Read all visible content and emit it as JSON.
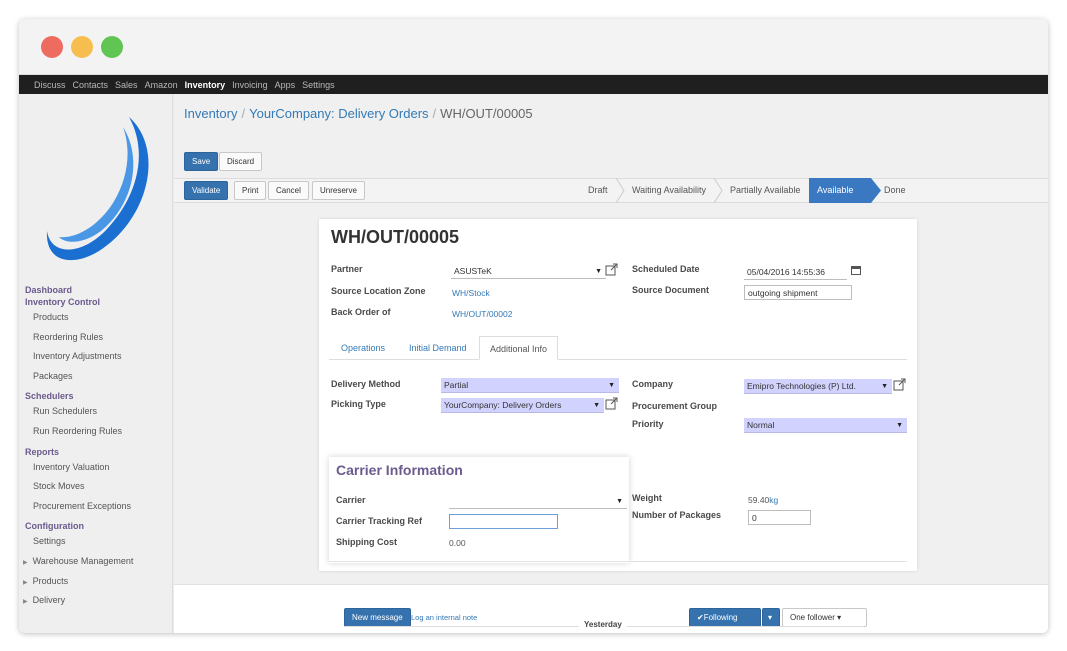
{
  "nav": {
    "items": [
      "Discuss",
      "Contacts",
      "Sales",
      "Amazon",
      "Inventory",
      "Invoicing",
      "Apps",
      "Settings"
    ],
    "active": "Inventory"
  },
  "sidebar": {
    "sections": [
      {
        "header": "Dashboard",
        "items": []
      },
      {
        "header": "Inventory Control",
        "items": [
          "Products",
          "Reordering Rules",
          "Inventory Adjustments",
          "Packages"
        ]
      },
      {
        "header": "Schedulers",
        "items": [
          "Run Schedulers",
          "Run Reordering Rules"
        ]
      },
      {
        "header": "Reports",
        "items": [
          "Inventory Valuation",
          "Stock Moves",
          "Procurement Exceptions"
        ]
      },
      {
        "header": "Configuration",
        "items": [
          "Settings"
        ]
      }
    ],
    "collapsible": [
      "Warehouse Management",
      "Products",
      "Delivery"
    ]
  },
  "breadcrumb": {
    "root": "Inventory",
    "parent": "YourCompany: Delivery Orders",
    "current": "WH/OUT/00005"
  },
  "buttons": {
    "save": "Save",
    "discard": "Discard",
    "validate": "Validate",
    "print": "Print",
    "cancel": "Cancel",
    "unreserve": "Unreserve"
  },
  "status": {
    "stages": [
      "Draft",
      "Waiting Availability",
      "Partially Available",
      "Available",
      "Done"
    ],
    "active": "Available"
  },
  "record": {
    "title": "WH/OUT/00005",
    "partner_label": "Partner",
    "partner": "ASUSTeK",
    "source_location_label": "Source Location Zone",
    "source_location": "WH/Stock",
    "back_order_label": "Back Order of",
    "back_order": "WH/OUT/00002",
    "scheduled_date_label": "Scheduled Date",
    "scheduled_date": "05/04/2016 14:55:36",
    "source_document_label": "Source Document",
    "source_document": "outgoing shipment"
  },
  "tabs": [
    "Operations",
    "Initial Demand",
    "Additional Info"
  ],
  "active_tab": "Additional Info",
  "additional_info": {
    "delivery_method_label": "Delivery Method",
    "delivery_method": "Partial",
    "picking_type_label": "Picking Type",
    "picking_type": "YourCompany: Delivery Orders",
    "company_label": "Company",
    "company": "Emipro Technologies (P) Ltd.",
    "procurement_group_label": "Procurement Group",
    "priority_label": "Priority",
    "priority": "Normal"
  },
  "carrier": {
    "title": "Carrier Information",
    "carrier_label": "Carrier",
    "carrier": "",
    "tracking_ref_label": "Carrier Tracking Ref",
    "tracking_ref": "",
    "shipping_cost_label": "Shipping Cost",
    "shipping_cost": "0.00",
    "weight_label": "Weight",
    "weight": "59.40",
    "weight_unit": "kg",
    "packages_label": "Number of Packages",
    "packages": "0"
  },
  "chatter": {
    "new_message": "New message",
    "log_note": "Log an internal note",
    "following": "Following",
    "followers": "One follower",
    "divider": "Yesterday"
  },
  "colors": {
    "primary": "#3572ae",
    "link": "#337ab7",
    "section_header": "#6b5a8e",
    "required_field": "#d2d2ff",
    "nav_bg": "#1f1f1f"
  }
}
